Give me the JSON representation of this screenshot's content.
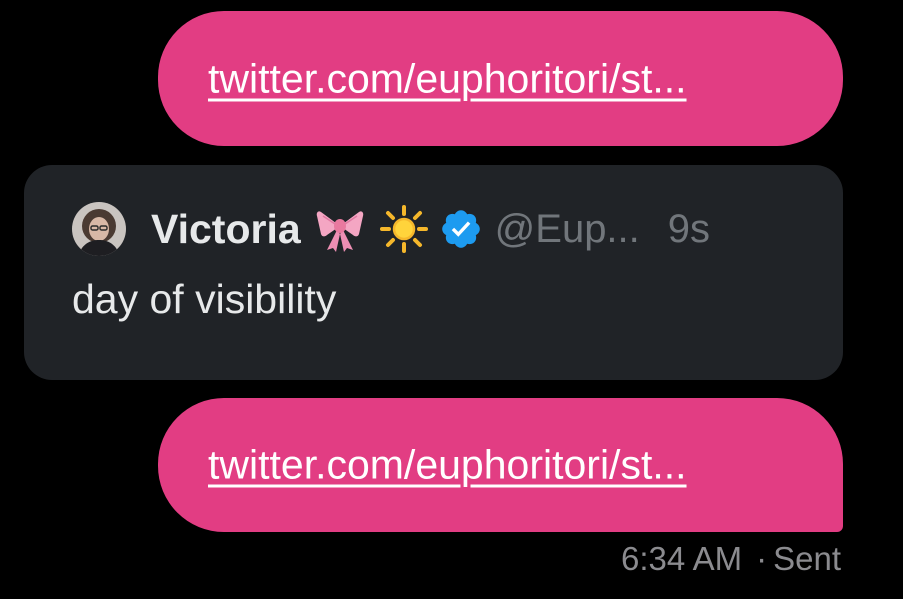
{
  "messages": [
    {
      "link_text": "twitter.com/euphoritori/st..."
    },
    {
      "link_text": "twitter.com/euphoritori/st..."
    }
  ],
  "tweet_card": {
    "display_name": "Victoria",
    "handle": "@Eup...",
    "time_ago": "9s",
    "text": "day of visibility",
    "emojis": [
      "ribbon-icon",
      "sun-icon"
    ],
    "verified": true
  },
  "status": {
    "time": "6:34 AM",
    "separator": "·",
    "state": "Sent"
  },
  "colors": {
    "bubble": "#e23d83",
    "card": "#202327",
    "background": "#000000",
    "verified": "#1d9bf0",
    "muted_text": "#71767b"
  }
}
